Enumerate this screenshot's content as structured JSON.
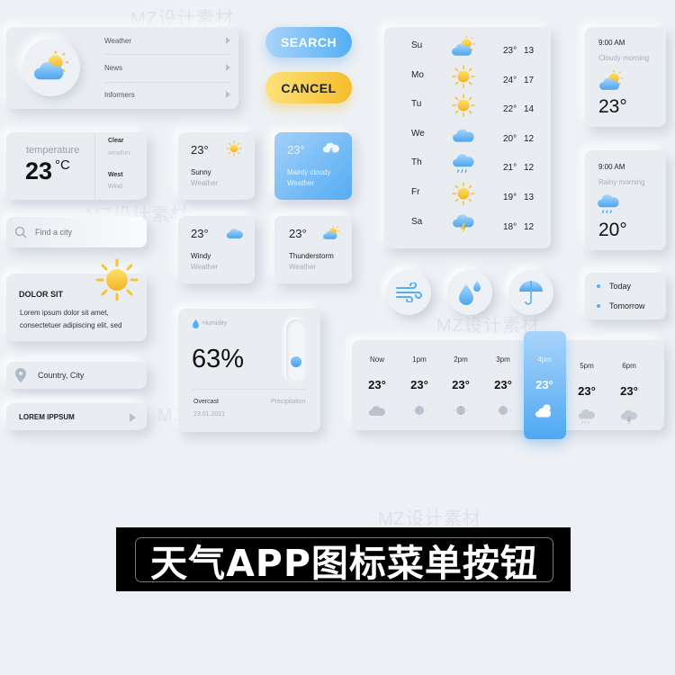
{
  "watermark": "MZ设计素材",
  "menu": {
    "items": [
      {
        "label": "Weather"
      },
      {
        "label": "News"
      },
      {
        "label": "Informers"
      }
    ]
  },
  "buttons": {
    "search": "SEARCH",
    "cancel": "CANCEL"
  },
  "temperature_card": {
    "label": "temperature",
    "value": "23",
    "unit": "°C",
    "cond1": "Clear",
    "cond1_sub": "weather",
    "cond2": "West",
    "cond2_sub": "Wind"
  },
  "search": {
    "placeholder": "Find a city"
  },
  "info_card": {
    "title": "DOLOR SIT",
    "body": "Lorem ipsum dolor sit amet, consectetuer adipiscing elit, sed"
  },
  "location": {
    "label": "Country, City"
  },
  "lorem_button": {
    "label": "LOREM IPPSUM"
  },
  "tiles": [
    {
      "temp": "23°",
      "title": "Sunny",
      "sub": "Weather",
      "icon": "sun-icon"
    },
    {
      "temp": "23°",
      "title": "Mainly cloudy",
      "sub": "Weather",
      "icon": "storm-cloud-icon"
    },
    {
      "temp": "23°",
      "title": "Windy",
      "sub": "Weather",
      "icon": "windy-cloud-icon"
    },
    {
      "temp": "23°",
      "title": "Thunderstorm",
      "sub": "Weather",
      "icon": "partly-cloudy-icon"
    }
  ],
  "humidity": {
    "label": "Humidity",
    "value": "63%",
    "level": 0.25,
    "cond": "Overcast",
    "date": "23.01.2021",
    "right": "Precipitation"
  },
  "week": [
    {
      "day": "Su",
      "icon": "partly-cloudy",
      "hi": "23°",
      "lo": "13"
    },
    {
      "day": "Mo",
      "icon": "sun",
      "hi": "24°",
      "lo": "17"
    },
    {
      "day": "Tu",
      "icon": "sun",
      "hi": "22°",
      "lo": "14"
    },
    {
      "day": "We",
      "icon": "cloud",
      "hi": "20°",
      "lo": "12"
    },
    {
      "day": "Th",
      "icon": "rain",
      "hi": "21°",
      "lo": "12"
    },
    {
      "day": "Fr",
      "icon": "sun",
      "hi": "19°",
      "lo": "13"
    },
    {
      "day": "Sa",
      "icon": "thunder",
      "hi": "18°",
      "lo": "12"
    }
  ],
  "mornings": [
    {
      "time": "9:00 AM",
      "desc": "Cloudy morning",
      "temp": "23°"
    },
    {
      "time": "9:00 AM",
      "desc": "Rainy morning",
      "temp": "20°"
    }
  ],
  "round_icons": [
    "wind-icon",
    "drops-icon",
    "umbrella-icon"
  ],
  "days": {
    "items": [
      {
        "label": "Today"
      },
      {
        "label": "Tomorrow"
      }
    ]
  },
  "hourly": [
    {
      "time": "Now",
      "temp": "23°",
      "icon": "cloud"
    },
    {
      "time": "1pm",
      "temp": "23°",
      "icon": "sun"
    },
    {
      "time": "2pm",
      "temp": "23°",
      "icon": "sun"
    },
    {
      "time": "3pm",
      "temp": "23°",
      "icon": "sun"
    },
    {
      "time": "4pm",
      "temp": "23°",
      "icon": "partly-cloudy",
      "active": true
    },
    {
      "time": "5pm",
      "temp": "23°",
      "icon": "rain"
    },
    {
      "time": "6pm",
      "temp": "23°",
      "icon": "thunder"
    }
  ],
  "banner": {
    "title": "天气APP图标菜单按钮"
  },
  "colors": {
    "blue": "#5ab2f5",
    "yellow": "#f7c530",
    "bg": "#edf0f4"
  }
}
